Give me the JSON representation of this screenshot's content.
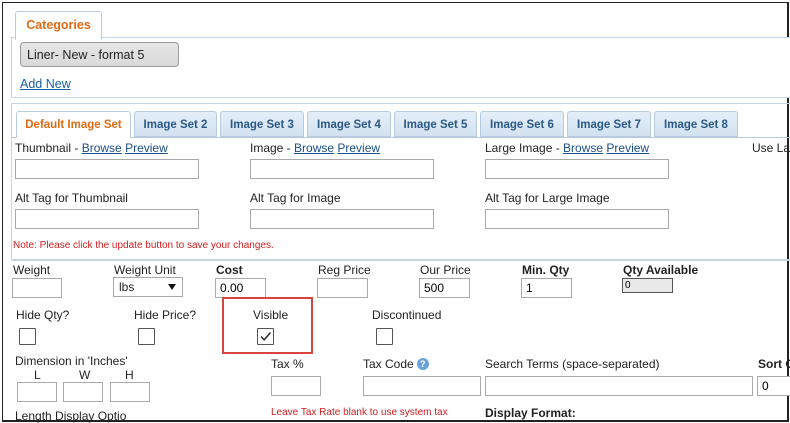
{
  "categories": {
    "tab_label": "Categories",
    "selected": "Liner- New - format 5",
    "add_new": "Add New"
  },
  "image_tabs": [
    "Default Image Set",
    "Image Set 2",
    "Image Set 3",
    "Image Set 4",
    "Image Set 5",
    "Image Set 6",
    "Image Set 7",
    "Image Set 8"
  ],
  "images": {
    "thumbnail_label": "Thumbnail - ",
    "image_label": "Image - ",
    "large_label": "Large Image - ",
    "browse": "Browse",
    "preview": "Preview",
    "use_label": "Use La",
    "alt_thumb": "Alt Tag for Thumbnail",
    "alt_image": "Alt Tag for Image",
    "alt_large": "Alt Tag for Large Image",
    "note": "Note: Please click the update button to save your changes."
  },
  "product": {
    "weight_label": "Weight",
    "weight_unit_label": "Weight Unit",
    "weight_unit_value": "lbs",
    "cost_label": "Cost",
    "cost_value": "0.00",
    "reg_price_label": "Reg Price",
    "our_price_label": "Our Price",
    "our_price_value": "500",
    "min_qty_label": "Min. Qty",
    "min_qty_value": "1",
    "qty_available_label": "Qty Available",
    "qty_available_value": "0",
    "hide_qty_label": "Hide Qty?",
    "hide_price_label": "Hide Price?",
    "visible_label": "Visible",
    "visible_checked": true,
    "discontinued_label": "Discontinued",
    "dimension_label": "Dimension in 'Inches'",
    "dim_l": "L",
    "dim_w": "W",
    "dim_h": "H",
    "tax_label": "Tax %",
    "tax_code_label": "Tax Code",
    "help_glyph": "?",
    "search_terms_label": "Search Terms (space-separated)",
    "sort_label": "Sort O",
    "sort_value": "0",
    "tax_note": "Leave Tax Rate blank to use system tax",
    "display_format_label": "Display Format:",
    "bottom_left_label": "Length   Display Optio"
  },
  "colors": {
    "accent": "#e06b14",
    "tab_text": "#2a5888",
    "link": "#1a5fa8",
    "warning": "#d21d1d",
    "highlight_box": "#d9443f"
  }
}
